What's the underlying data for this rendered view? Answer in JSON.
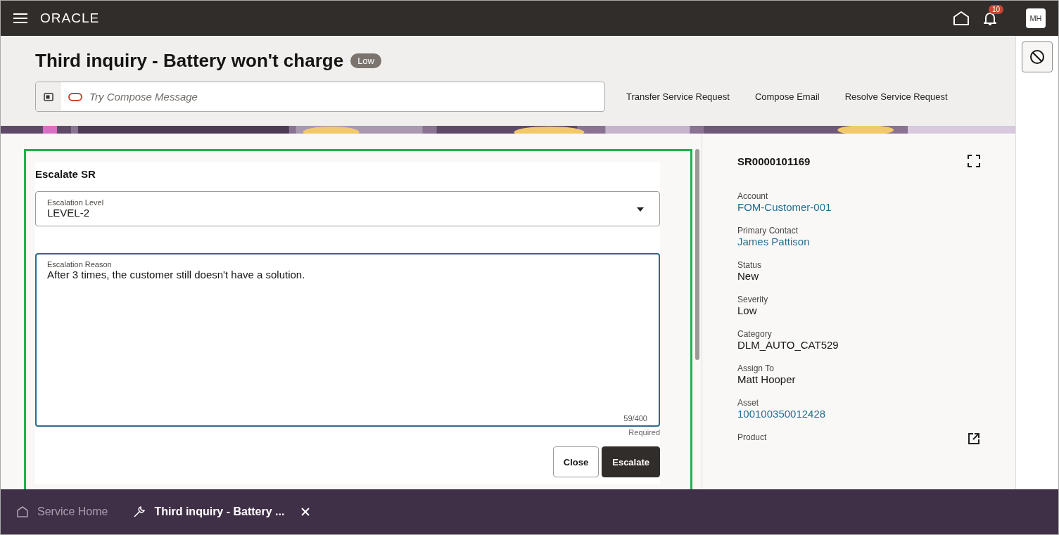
{
  "header": {
    "brand": "ORACLE",
    "notifications_count": "10",
    "avatar": "MH"
  },
  "title": "Third inquiry - Battery won't charge",
  "priority_badge": "Low",
  "compose": {
    "placeholder": "Try Compose Message"
  },
  "actions": [
    "Transfer Service Request",
    "Compose Email",
    "Resolve Service Request"
  ],
  "escalate_form": {
    "title": "Escalate SR",
    "level_field": {
      "label": "Escalation Level",
      "value": "LEVEL-2"
    },
    "reason_field": {
      "label": "Escalation Reason",
      "value": "After 3 times, the customer still doesn't have a solution.",
      "counter": "59/400",
      "hint": "Required"
    },
    "buttons": [
      {
        "label": "Close",
        "kind": "secondary"
      },
      {
        "label": "Escalate",
        "kind": "primary"
      }
    ]
  },
  "details": {
    "id": "SR0000101169",
    "fields": [
      {
        "label": "Account",
        "value": "FOM-Customer-001",
        "kind": "link"
      },
      {
        "label": "Primary Contact",
        "value": "James Pattison",
        "kind": "link"
      },
      {
        "label": "Status",
        "value": "New",
        "kind": "text"
      },
      {
        "label": "Severity",
        "value": "Low",
        "kind": "text"
      },
      {
        "label": "Category",
        "value": "DLM_AUTO_CAT529",
        "kind": "text"
      },
      {
        "label": "Assign To",
        "value": "Matt Hooper",
        "kind": "text"
      },
      {
        "label": "Asset",
        "value": "100100350012428",
        "kind": "link"
      },
      {
        "label": "Product",
        "kind": "external"
      }
    ]
  },
  "bottom_tabs": [
    {
      "label": "Service Home",
      "kind": "home",
      "selected": false,
      "closable": false
    },
    {
      "label": "Third inquiry - Battery ...",
      "kind": "work",
      "selected": true,
      "closable": true
    }
  ]
}
